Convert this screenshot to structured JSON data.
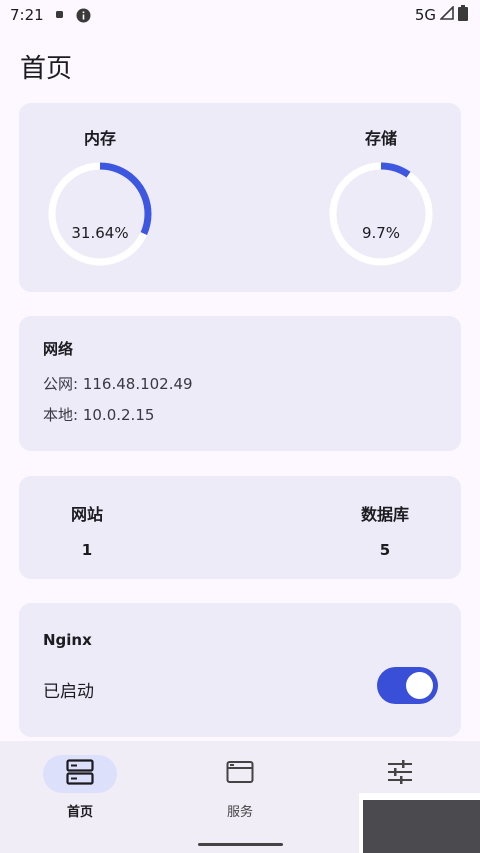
{
  "status_bar": {
    "time": "7:21",
    "network": "5G",
    "icons": [
      "notification-dot-icon",
      "info-icon",
      "signal-icon",
      "battery-icon"
    ]
  },
  "page": {
    "title": "首页"
  },
  "usage": {
    "memory": {
      "label": "内存",
      "value_text": "31.64%",
      "fraction": 0.3164
    },
    "storage": {
      "label": "存储",
      "value_text": "9.7%",
      "fraction": 0.097
    },
    "colors": {
      "arc": "#3d57e0",
      "track": "#ffffff"
    }
  },
  "network": {
    "title": "网络",
    "public_label": "公网:",
    "public_ip": "116.48.102.49",
    "local_label": "本地:",
    "local_ip": "10.0.2.15"
  },
  "counts": {
    "sites": {
      "label": "网站",
      "value": "1"
    },
    "databases": {
      "label": "数据库",
      "value": "5"
    }
  },
  "nginx": {
    "title": "Nginx",
    "status": "已启动",
    "enabled": true
  },
  "bottom_nav": {
    "items": [
      {
        "label": "首页",
        "icon": "server-icon",
        "active": true
      },
      {
        "label": "服务",
        "icon": "window-icon",
        "active": false
      },
      {
        "label": "",
        "icon": "sliders-icon",
        "active": false
      }
    ]
  }
}
